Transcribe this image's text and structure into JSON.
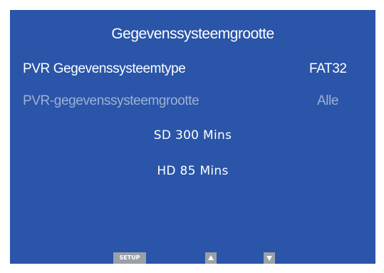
{
  "menu": {
    "title": "Gegevenssysteemgrootte",
    "rows": [
      {
        "label": "PVR Gegevenssysteemtype",
        "value": "FAT32"
      },
      {
        "label": "PVR-gegevenssysteemgrootte",
        "value": "Alle"
      }
    ],
    "info": {
      "sd": "SD 300 Mins",
      "hd": "HD 85 Mins"
    }
  },
  "keys": {
    "setup_label": "SETUP",
    "up_icon": "up-arrow-icon",
    "down_icon": "down-arrow-icon"
  },
  "colors": {
    "background": "#2a55a8",
    "text": "#ffffff",
    "disabled_text": "#9fb0d6",
    "key": "#9aa0a8"
  }
}
